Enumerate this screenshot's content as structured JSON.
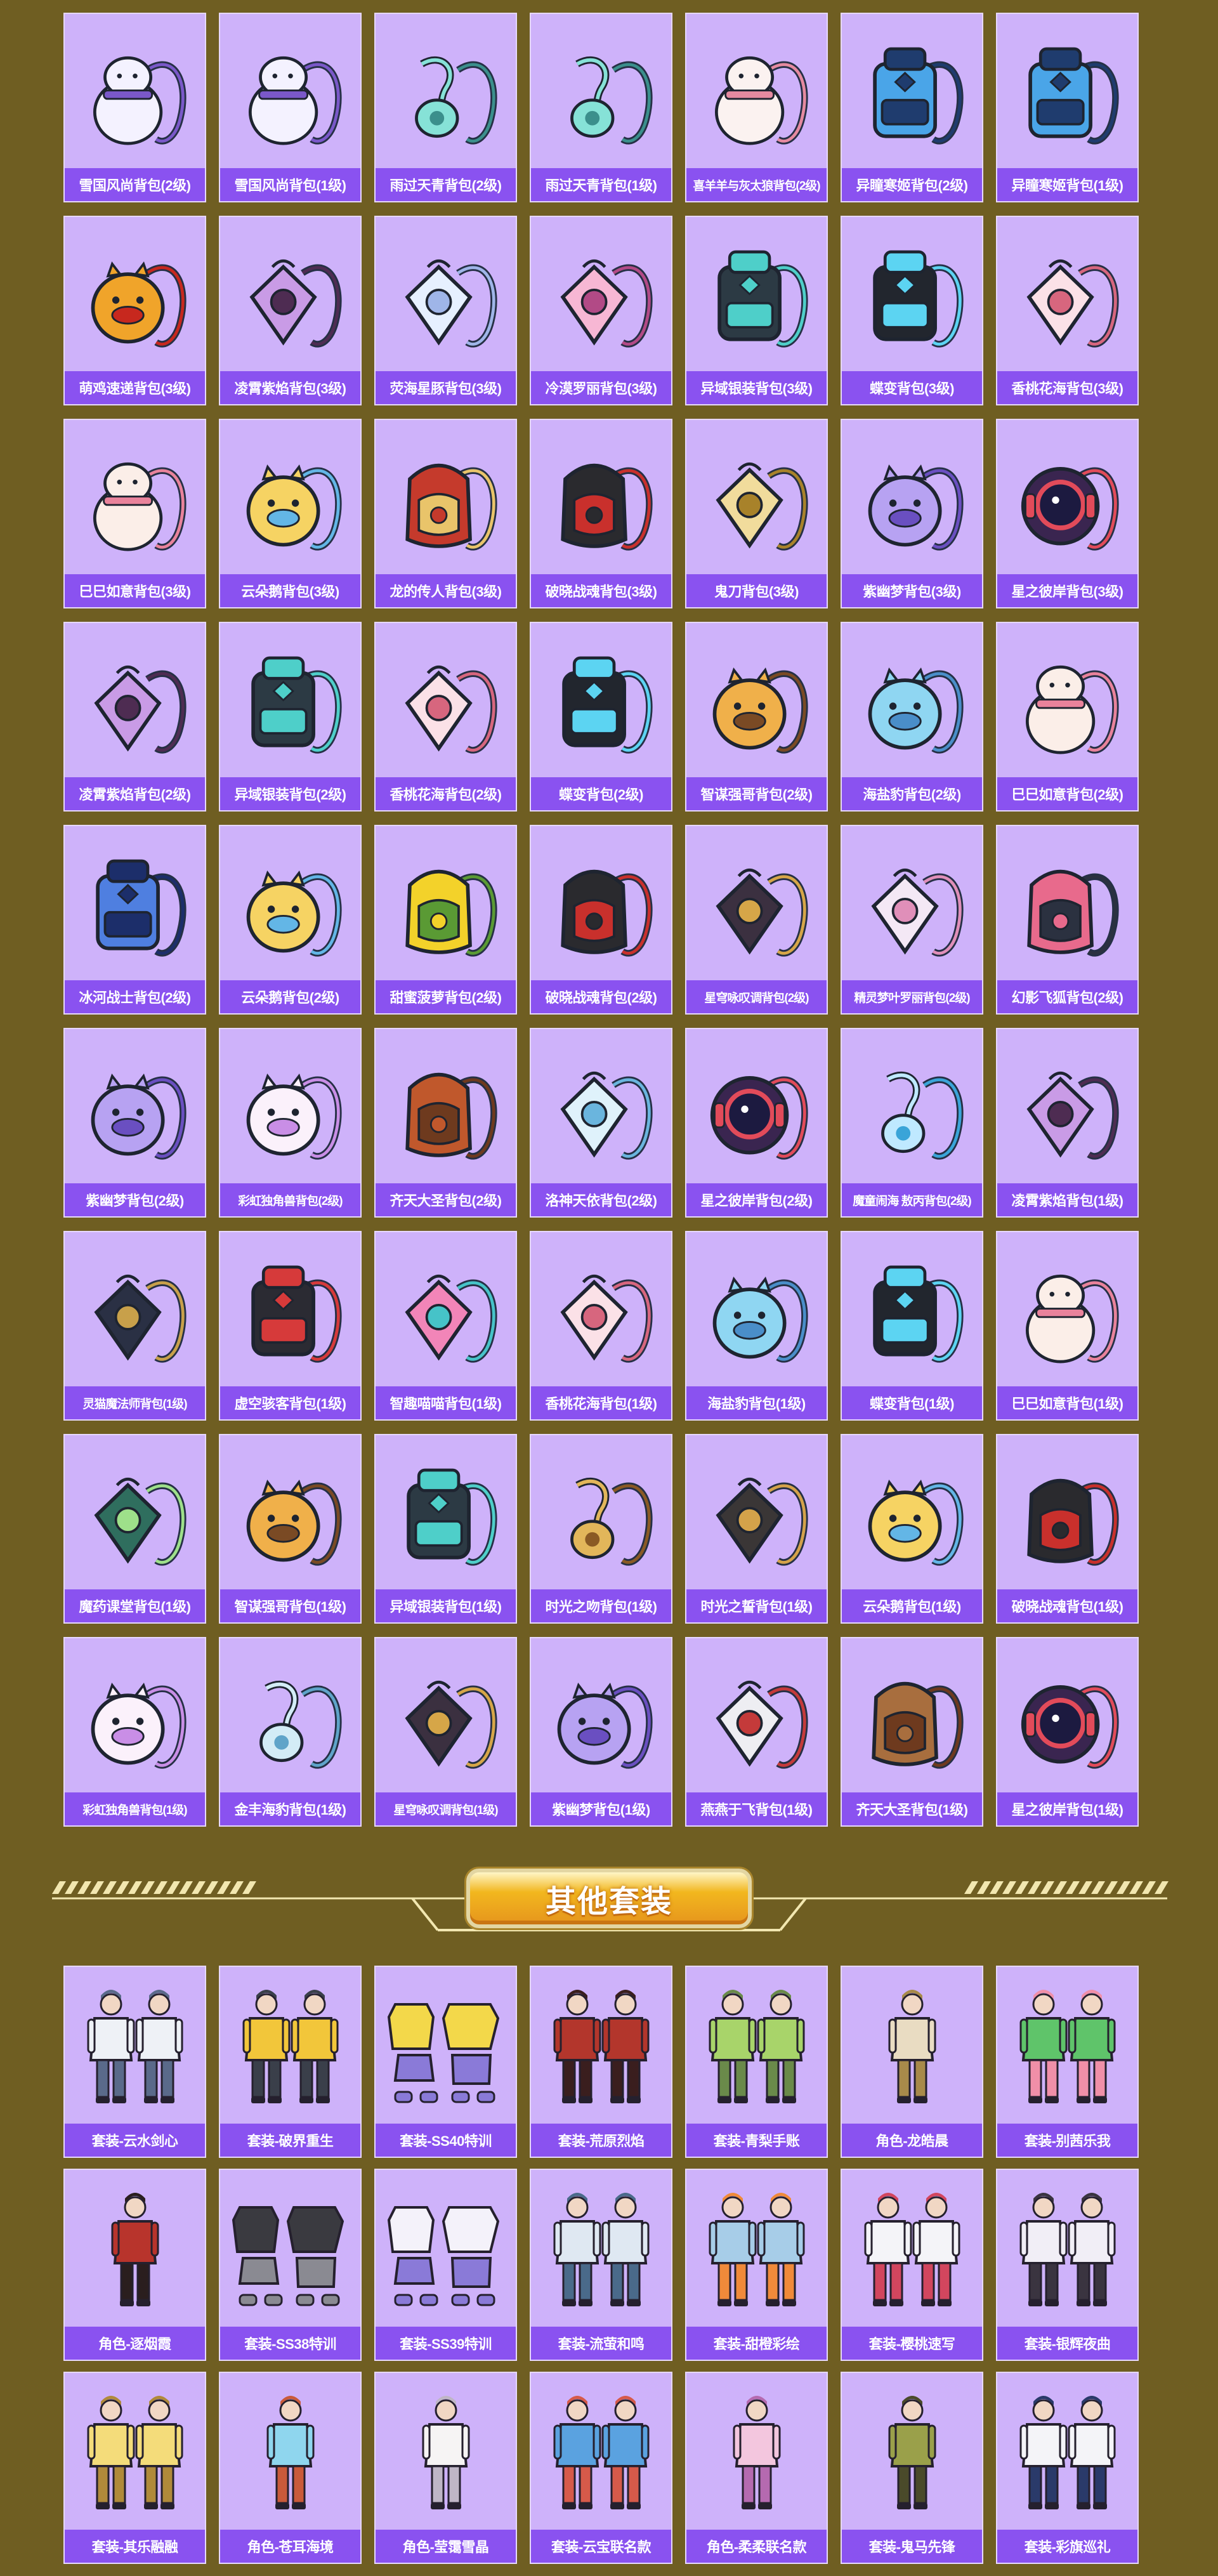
{
  "backpacks": [
    {
      "label": "雪国风尚背包(2级)",
      "icon": "snowman-backpack-icon",
      "c1": "#f4f2ff",
      "c2": "#7a58c9"
    },
    {
      "label": "雪国风尚背包(1级)",
      "icon": "snowman-backpack-icon",
      "c1": "#f4f2ff",
      "c2": "#7a58c9"
    },
    {
      "label": "雨过天青背包(2级)",
      "icon": "jade-pendant-backpack-icon",
      "c1": "#86e2d7",
      "c2": "#3b8f8c"
    },
    {
      "label": "雨过天青背包(1级)",
      "icon": "jade-pendant-backpack-icon",
      "c1": "#86e2d7",
      "c2": "#3b8f8c"
    },
    {
      "label": "喜羊羊与灰太狼背包(2级)",
      "icon": "sheep-backpack-icon",
      "c1": "#fbf2f0",
      "c2": "#e58aa0"
    },
    {
      "label": "异瞳寒姬背包(2级)",
      "icon": "blue-mech-backpack-icon",
      "c1": "#4aa5e8",
      "c2": "#1f3c6e"
    },
    {
      "label": "异瞳寒姬背包(1级)",
      "icon": "blue-mech-backpack-icon",
      "c1": "#4aa5e8",
      "c2": "#1f3c6e"
    },
    {
      "label": "萌鸡速递背包(3级)",
      "icon": "chick-backpack-icon",
      "c1": "#f0a42a",
      "c2": "#c7281e"
    },
    {
      "label": "凌霄紫焰背包(3级)",
      "icon": "purple-flame-backpack-icon",
      "c1": "#c99be6",
      "c2": "#4e2c52"
    },
    {
      "label": "荧海星豚背包(3级)",
      "icon": "star-dolphin-backpack-icon",
      "c1": "#e6f0ff",
      "c2": "#9fb5e8"
    },
    {
      "label": "冷漠罗丽背包(3级)",
      "icon": "pink-heart-backpack-icon",
      "c1": "#f7b7d4",
      "c2": "#b24a86"
    },
    {
      "label": "异域银装背包(3级)",
      "icon": "dark-tech-backpack-icon",
      "c1": "#2c3a44",
      "c2": "#4ecfc9"
    },
    {
      "label": "蝶变背包(3级)",
      "icon": "butterfly-backpack-icon",
      "c1": "#22262e",
      "c2": "#5cd4f2"
    },
    {
      "label": "香桃花海背包(3级)",
      "icon": "peach-blossom-backpack-icon",
      "c1": "#fbe1e7",
      "c2": "#d7667e"
    },
    {
      "label": "巳巳如意背包(3级)",
      "icon": "snake-bun-backpack-icon",
      "c1": "#fbeee8",
      "c2": "#e9829b"
    },
    {
      "label": "云朵鹅背包(3级)",
      "icon": "cloud-goose-backpack-icon",
      "c1": "#f6d363",
      "c2": "#63b6e6"
    },
    {
      "label": "龙的传人背包(3级)",
      "icon": "dragon-heir-backpack-icon",
      "c1": "#c53a2c",
      "c2": "#e9c46a"
    },
    {
      "label": "破晓战魂背包(3级)",
      "icon": "dawn-warrior-backpack-icon",
      "c1": "#2a2a2e",
      "c2": "#c9302c"
    },
    {
      "label": "鬼刀背包(3级)",
      "icon": "ghost-blade-backpack-icon",
      "c1": "#f1dc9c",
      "c2": "#a8822a"
    },
    {
      "label": "紫幽梦背包(3级)",
      "icon": "purple-dream-backpack-icon",
      "c1": "#b7a2f2",
      "c2": "#6a4fc1"
    },
    {
      "label": "星之彼岸背包(3级)",
      "icon": "star-shore-backpack-icon",
      "c1": "#3a2550",
      "c2": "#e24b5a"
    },
    {
      "label": "凌霄紫焰背包(2级)",
      "icon": "purple-flame-backpack-icon",
      "c1": "#c99be6",
      "c2": "#4e2c52"
    },
    {
      "label": "异域银装背包(2级)",
      "icon": "dark-tech-backpack-icon",
      "c1": "#2c3a44",
      "c2": "#4ecfc9"
    },
    {
      "label": "香桃花海背包(2级)",
      "icon": "peach-blossom-backpack-icon",
      "c1": "#fbe1e7",
      "c2": "#d7667e"
    },
    {
      "label": "蝶变背包(2级)",
      "icon": "butterfly-backpack-icon",
      "c1": "#22262e",
      "c2": "#5cd4f2"
    },
    {
      "label": "智谋强哥背包(2级)",
      "icon": "mushroom-backpack-icon",
      "c1": "#f0b04a",
      "c2": "#7a4a24"
    },
    {
      "label": "海盐豹背包(2级)",
      "icon": "sea-leopard-backpack-icon",
      "c1": "#8fd6f2",
      "c2": "#4a8ec9"
    },
    {
      "label": "巳巳如意背包(2级)",
      "icon": "snake-bun-backpack-icon",
      "c1": "#fbeee8",
      "c2": "#e9829b"
    },
    {
      "label": "冰河战士背包(2级)",
      "icon": "glacier-warrior-backpack-icon",
      "c1": "#4f7fe0",
      "c2": "#1c2e6a"
    },
    {
      "label": "云朵鹅背包(2级)",
      "icon": "cloud-goose-backpack-icon",
      "c1": "#f6d363",
      "c2": "#63b6e6"
    },
    {
      "label": "甜蜜菠萝背包(2级)",
      "icon": "pineapple-backpack-icon",
      "c1": "#f3d22a",
      "c2": "#5a9a34"
    },
    {
      "label": "破晓战魂背包(2级)",
      "icon": "dawn-warrior-backpack-icon",
      "c1": "#2a2a2e",
      "c2": "#c9302c"
    },
    {
      "label": "星穹咏叹调背包(2级)",
      "icon": "starry-aria-backpack-icon",
      "c1": "#3b3040",
      "c2": "#d6a648"
    },
    {
      "label": "精灵梦叶罗丽背包(2级)",
      "icon": "fairy-heart-backpack-icon",
      "c1": "#f4e8f5",
      "c2": "#e08fb9"
    },
    {
      "label": "幻影飞狐背包(2级)",
      "icon": "phantom-fox-backpack-icon",
      "c1": "#e86a8c",
      "c2": "#2b3140"
    },
    {
      "label": "紫幽梦背包(2级)",
      "icon": "purple-dream-backpack-icon",
      "c1": "#b7a2f2",
      "c2": "#6a4fc1"
    },
    {
      "label": "彩虹独角兽背包(2级)",
      "icon": "rainbow-unicorn-backpack-icon",
      "c1": "#fbf1fb",
      "c2": "#c98ee6"
    },
    {
      "label": "齐天大圣背包(2级)",
      "icon": "monkey-king-backpack-icon",
      "c1": "#c0582c",
      "c2": "#6e3a1e"
    },
    {
      "label": "洛神天依背包(2级)",
      "icon": "luo-tianyi-backpack-icon",
      "c1": "#dff2fb",
      "c2": "#6ab5de"
    },
    {
      "label": "星之彼岸背包(2级)",
      "icon": "star-shore-backpack-icon",
      "c1": "#3a2550",
      "c2": "#e24b5a"
    },
    {
      "label": "魔童闹海 敖丙背包(2级)",
      "icon": "ao-bing-backpack-icon",
      "c1": "#bfe9ff",
      "c2": "#3aa4d8"
    },
    {
      "label": "凌霄紫焰背包(1级)",
      "icon": "purple-flame-backpack-icon",
      "c1": "#c99be6",
      "c2": "#4e2c52"
    },
    {
      "label": "灵猫魔法师背包(1级)",
      "icon": "cat-mage-backpack-icon",
      "c1": "#2a3044",
      "c2": "#c8a04a"
    },
    {
      "label": "虚空骇客背包(1级)",
      "icon": "void-hacker-backpack-icon",
      "c1": "#2b2b33",
      "c2": "#d63a3a"
    },
    {
      "label": "智趣喵喵背包(1级)",
      "icon": "arcade-cat-backpack-icon",
      "c1": "#f285b8",
      "c2": "#46c3c8"
    },
    {
      "label": "香桃花海背包(1级)",
      "icon": "peach-blossom-backpack-icon",
      "c1": "#fbe1e7",
      "c2": "#d7667e"
    },
    {
      "label": "海盐豹背包(1级)",
      "icon": "sea-leopard-backpack-icon",
      "c1": "#8fd6f2",
      "c2": "#4a8ec9"
    },
    {
      "label": "蝶变背包(1级)",
      "icon": "butterfly-backpack-icon",
      "c1": "#22262e",
      "c2": "#5cd4f2"
    },
    {
      "label": "巳巳如意背包(1级)",
      "icon": "snake-bun-backpack-icon",
      "c1": "#fbeee8",
      "c2": "#e9829b"
    },
    {
      "label": "魔药课堂背包(1级)",
      "icon": "potion-class-backpack-icon",
      "c1": "#2f6e5e",
      "c2": "#9ee08a"
    },
    {
      "label": "智谋强哥背包(1级)",
      "icon": "mushroom-backpack-icon",
      "c1": "#f0b04a",
      "c2": "#7a4a24"
    },
    {
      "label": "异域银装背包(1级)",
      "icon": "dark-tech-backpack-icon",
      "c1": "#2c3a44",
      "c2": "#4ecfc9"
    },
    {
      "label": "时光之吻背包(1级)",
      "icon": "time-kiss-backpack-icon",
      "c1": "#e2b65a",
      "c2": "#8a5a24"
    },
    {
      "label": "时光之誓背包(1级)",
      "icon": "time-oath-backpack-icon",
      "c1": "#3a3636",
      "c2": "#d4a24a"
    },
    {
      "label": "云朵鹅背包(1级)",
      "icon": "cloud-goose-backpack-icon",
      "c1": "#f6d363",
      "c2": "#63b6e6"
    },
    {
      "label": "破晓战魂背包(1级)",
      "icon": "dawn-warrior-backpack-icon",
      "c1": "#2a2a2e",
      "c2": "#c9302c"
    },
    {
      "label": "彩虹独角兽背包(1级)",
      "icon": "rainbow-unicorn-backpack-icon",
      "c1": "#fbf1fb",
      "c2": "#c98ee6"
    },
    {
      "label": "金丰海豹背包(1级)",
      "icon": "golden-seal-backpack-icon",
      "c1": "#d3ecf6",
      "c2": "#5fa4c9"
    },
    {
      "label": "星穹咏叹调背包(1级)",
      "icon": "starry-aria-backpack-icon",
      "c1": "#3b3040",
      "c2": "#d6a648"
    },
    {
      "label": "紫幽梦背包(1级)",
      "icon": "purple-dream-backpack-icon",
      "c1": "#b7a2f2",
      "c2": "#6a4fc1"
    },
    {
      "label": "燕燕于飞背包(1级)",
      "icon": "swallow-backpack-icon",
      "c1": "#eeeef2",
      "c2": "#c43a3a"
    },
    {
      "label": "齐天大圣背包(1级)",
      "icon": "monkey-king-backpack-icon",
      "c1": "#a86e3e",
      "c2": "#6e3a1e"
    },
    {
      "label": "星之彼岸背包(1级)",
      "icon": "star-shore-backpack-icon",
      "c1": "#3a2550",
      "c2": "#e24b5a"
    }
  ],
  "section": {
    "title": "其他套装"
  },
  "outfits": [
    {
      "label": "套装-云水剑心",
      "icon": "outfit-pair-icon",
      "c1": "#eef1f6",
      "c2": "#5a6a8a"
    },
    {
      "label": "套装-破界重生",
      "icon": "outfit-pair-icon",
      "c1": "#f2c63a",
      "c2": "#3a3f4a"
    },
    {
      "label": "套装-SS40特训",
      "icon": "outfit-set-icon",
      "c1": "#f3d84a",
      "c2": "#8a7ad8"
    },
    {
      "label": "套装-荒原烈焰",
      "icon": "outfit-pair-icon",
      "c1": "#b3362c",
      "c2": "#3a1e1e"
    },
    {
      "label": "套装-青梨手账",
      "icon": "outfit-pair-icon",
      "c1": "#a8d46a",
      "c2": "#6a8a4a"
    },
    {
      "label": "角色-龙皓晨",
      "icon": "character-icon",
      "c1": "#e9dcc2",
      "c2": "#a88a4a"
    },
    {
      "label": "套装-别茜乐我",
      "icon": "outfit-pair-icon",
      "c1": "#5fc46a",
      "c2": "#f08fa8"
    },
    {
      "label": "角色-逐烟霞",
      "icon": "character-icon",
      "c1": "#b8342c",
      "c2": "#2a1e1e"
    },
    {
      "label": "套装-SS38特训",
      "icon": "outfit-set-icon",
      "c1": "#3a3a40",
      "c2": "#8a8a92"
    },
    {
      "label": "套装-SS39特训",
      "icon": "outfit-set-icon",
      "c1": "#f4f2fa",
      "c2": "#8a7ad8"
    },
    {
      "label": "套装-流萤和鸣",
      "icon": "outfit-pair-icon",
      "c1": "#dfe8f2",
      "c2": "#4a6a8a"
    },
    {
      "label": "套装-甜橙彩绘",
      "icon": "outfit-pair-icon",
      "c1": "#a7cde8",
      "c2": "#f08a3a"
    },
    {
      "label": "套装-樱桃速写",
      "icon": "outfit-pair-icon",
      "c1": "#f4f4f8",
      "c2": "#d2465e"
    },
    {
      "label": "套装-银辉夜曲",
      "icon": "outfit-pair-icon",
      "c1": "#f1eef6",
      "c2": "#3a3440"
    },
    {
      "label": "套装-其乐融融",
      "icon": "outfit-pair-icon",
      "c1": "#f4dc7a",
      "c2": "#b08a3a"
    },
    {
      "label": "角色-苍耳海境",
      "icon": "character-icon",
      "c1": "#8fd6ee",
      "c2": "#c95a3a"
    },
    {
      "label": "角色-莹霭雪晶",
      "icon": "character-icon",
      "c1": "#f6f4f4",
      "c2": "#bfb6c6"
    },
    {
      "label": "套装-云宝联名款",
      "icon": "outfit-pair-icon",
      "c1": "#5aa2e0",
      "c2": "#d65a4a"
    },
    {
      "label": "角色-柔柔联名款",
      "icon": "character-icon",
      "c1": "#f3c6de",
      "c2": "#b56ab0"
    },
    {
      "label": "套装-鬼马先锋",
      "icon": "character-icon",
      "c1": "#9aa04a",
      "c2": "#4a4a2a"
    },
    {
      "label": "套装-彩旗巡礼",
      "icon": "outfit-pair-icon",
      "c1": "#f4f4f8",
      "c2": "#2a3a6a"
    }
  ],
  "colors": {
    "background": "#6f5e22",
    "card": "#ceb2fa",
    "label_bar": "#8a52f0",
    "banner": "#f2b71e"
  }
}
